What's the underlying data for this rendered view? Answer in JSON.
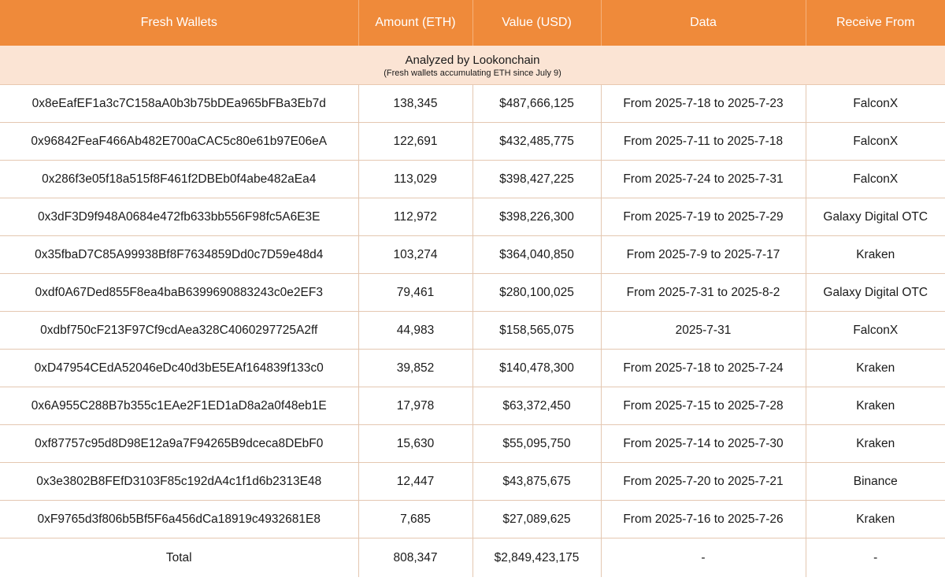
{
  "header": {
    "columns": [
      "Fresh Wallets",
      "Amount (ETH)",
      "Value (USD)",
      "Data",
      "Receive From"
    ]
  },
  "banner": {
    "title": "Analyzed by Lookonchain",
    "subtitle": "(Fresh wallets accumulating ETH since July 9)"
  },
  "colors": {
    "header_bg": "#ef8a3a",
    "banner_bg": "#fbe4d4",
    "grid_line": "#e4c7b1"
  },
  "rows": [
    {
      "wallet": "0x8eEafEF1a3c7C158aA0b3b75bDEa965bFBa3Eb7d",
      "amount": "138,345",
      "value": "$487,666,125",
      "date": "From 2025-7-18 to 2025-7-23",
      "from": "FalconX"
    },
    {
      "wallet": "0x96842FeaF466Ab482E700aCAC5c80e61b97E06eA",
      "amount": "122,691",
      "value": "$432,485,775",
      "date": "From 2025-7-11 to 2025-7-18",
      "from": "FalconX"
    },
    {
      "wallet": "0x286f3e05f18a515f8F461f2DBEb0f4abe482aEa4",
      "amount": "113,029",
      "value": "$398,427,225",
      "date": "From 2025-7-24 to 2025-7-31",
      "from": "FalconX"
    },
    {
      "wallet": "0x3dF3D9f948A0684e472fb633bb556F98fc5A6E3E",
      "amount": "112,972",
      "value": "$398,226,300",
      "date": "From 2025-7-19 to 2025-7-29",
      "from": "Galaxy Digital OTC"
    },
    {
      "wallet": "0x35fbaD7C85A99938Bf8F7634859Dd0c7D59e48d4",
      "amount": "103,274",
      "value": "$364,040,850",
      "date": "From 2025-7-9 to 2025-7-17",
      "from": "Kraken"
    },
    {
      "wallet": "0xdf0A67Ded855F8ea4baB6399690883243c0e2EF3",
      "amount": "79,461",
      "value": "$280,100,025",
      "date": "From 2025-7-31 to 2025-8-2",
      "from": "Galaxy Digital OTC"
    },
    {
      "wallet": "0xdbf750cF213F97Cf9cdAea328C4060297725A2ff",
      "amount": "44,983",
      "value": "$158,565,075",
      "date": "2025-7-31",
      "from": "FalconX"
    },
    {
      "wallet": "0xD47954CEdA52046eDc40d3bE5EAf164839f133c0",
      "amount": "39,852",
      "value": "$140,478,300",
      "date": "From 2025-7-18 to 2025-7-24",
      "from": "Kraken"
    },
    {
      "wallet": "0x6A955C288B7b355c1EAe2F1ED1aD8a2a0f48eb1E",
      "amount": "17,978",
      "value": "$63,372,450",
      "date": "From 2025-7-15 to 2025-7-28",
      "from": "Kraken"
    },
    {
      "wallet": "0xf87757c95d8D98E12a9a7F94265B9dceca8DEbF0",
      "amount": "15,630",
      "value": "$55,095,750",
      "date": "From 2025-7-14 to 2025-7-30",
      "from": "Kraken"
    },
    {
      "wallet": "0x3e3802B8FEfD3103F85c192dA4c1f1d6b2313E48",
      "amount": "12,447",
      "value": "$43,875,675",
      "date": "From 2025-7-20 to 2025-7-21",
      "from": "Binance"
    },
    {
      "wallet": "0xF9765d3f806b5Bf5F6a456dCa18919c4932681E8",
      "amount": "7,685",
      "value": "$27,089,625",
      "date": "From 2025-7-16 to 2025-7-26",
      "from": "Kraken"
    }
  ],
  "total": {
    "label": "Total",
    "amount": "808,347",
    "value": "$2,849,423,175",
    "date": "-",
    "from": "-"
  }
}
